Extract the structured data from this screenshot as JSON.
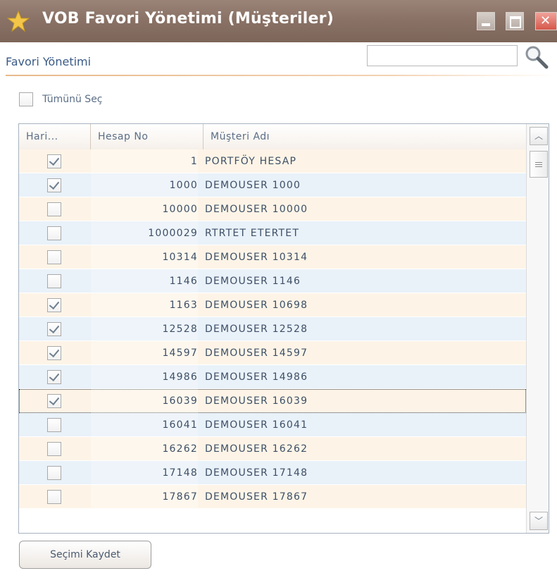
{
  "window": {
    "title": "VOB Favori Yönetimi (Müşteriler)",
    "title_bar_color": "#8a7266",
    "star_color": "#f3c64a"
  },
  "header": {
    "section_title": "Favori Yönetimi",
    "search": {
      "value": "",
      "placeholder": ""
    }
  },
  "select_all": {
    "label": "Tümünü Seç",
    "checked": false
  },
  "grid": {
    "columns": [
      "Hari...",
      "Hesap No",
      "Müşteri Adı"
    ],
    "rows": [
      {
        "checked": true,
        "account_no": "1",
        "customer_name": "PORTFÖY HESAP"
      },
      {
        "checked": true,
        "account_no": "1000",
        "customer_name": "DEMOUSER 1000"
      },
      {
        "checked": false,
        "account_no": "10000",
        "customer_name": "DEMOUSER 10000"
      },
      {
        "checked": false,
        "account_no": "1000029",
        "customer_name": "RTRTET ETERTET"
      },
      {
        "checked": false,
        "account_no": "10314",
        "customer_name": "DEMOUSER 10314"
      },
      {
        "checked": false,
        "account_no": "1146",
        "customer_name": "DEMOUSER 1146"
      },
      {
        "checked": true,
        "account_no": "1163",
        "customer_name": "DEMOUSER 10698"
      },
      {
        "checked": true,
        "account_no": "12528",
        "customer_name": "DEMOUSER 12528"
      },
      {
        "checked": true,
        "account_no": "14597",
        "customer_name": "DEMOUSER 14597"
      },
      {
        "checked": true,
        "account_no": "14986",
        "customer_name": "DEMOUSER 14986"
      },
      {
        "checked": true,
        "account_no": "16039",
        "customer_name": "DEMOUSER 16039",
        "focused": true
      },
      {
        "checked": false,
        "account_no": "16041",
        "customer_name": "DEMOUSER 16041"
      },
      {
        "checked": false,
        "account_no": "16262",
        "customer_name": "DEMOUSER 16262"
      },
      {
        "checked": false,
        "account_no": "17148",
        "customer_name": "DEMOUSER 17148"
      },
      {
        "checked": false,
        "account_no": "17867",
        "customer_name": "DEMOUSER 17867"
      }
    ],
    "odd_row_color": "#fdf4e7",
    "even_row_color": "#e9f1f9"
  },
  "footer": {
    "save_label": "Seçimi Kaydet"
  },
  "icons": {
    "window_icon": "star-icon",
    "search": "magnifier-icon",
    "scroll_up": "chevron-up-icon",
    "scroll_down": "chevron-down-icon"
  }
}
